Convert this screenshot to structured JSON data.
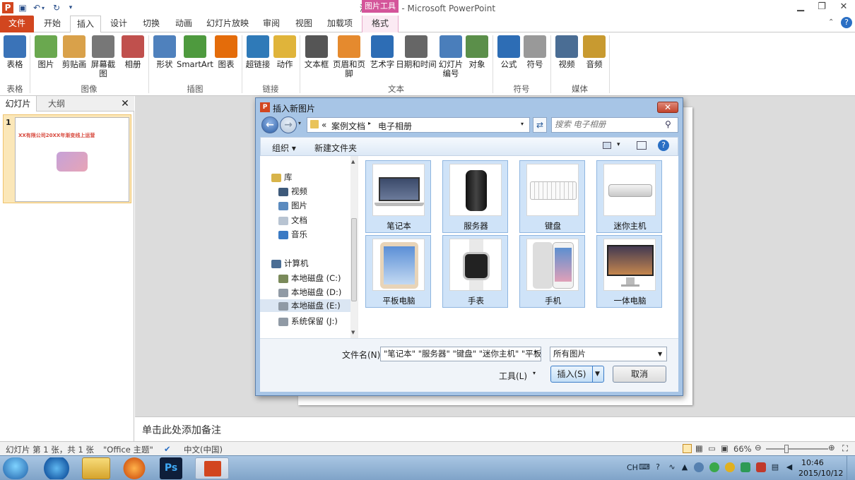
{
  "window": {
    "title": "演示文稿1 - Microsoft PowerPoint",
    "picture_tools": "图片工具",
    "min_icon": "minimize-icon",
    "max_icon": "restore-icon",
    "close_icon": "close-icon"
  },
  "quick_access": {
    "app_letter": "P",
    "save": "save-icon",
    "undo": "undo-icon",
    "redo": "redo-icon",
    "customize": "customize-icon"
  },
  "tabs": [
    {
      "label": "文件"
    },
    {
      "label": "开始"
    },
    {
      "label": "插入"
    },
    {
      "label": "设计"
    },
    {
      "label": "切换"
    },
    {
      "label": "动画"
    },
    {
      "label": "幻灯片放映"
    },
    {
      "label": "审阅"
    },
    {
      "label": "视图"
    },
    {
      "label": "加载项"
    },
    {
      "label": "格式"
    }
  ],
  "ribbon": {
    "buttons": [
      {
        "label": "表格",
        "icon": "table-icon",
        "color": "#3a73b8"
      },
      {
        "label": "图片",
        "icon": "picture-icon",
        "color": "#6aa84f"
      },
      {
        "label": "剪贴画",
        "icon": "clipart-icon",
        "color": "#d9a14a"
      },
      {
        "label": "屏幕截图",
        "icon": "screenshot-icon",
        "color": "#777777"
      },
      {
        "label": "相册",
        "icon": "album-icon",
        "color": "#c0504d"
      },
      {
        "label": "形状",
        "icon": "shapes-icon",
        "color": "#4f81bd"
      },
      {
        "label": "SmartArt",
        "icon": "smartart-icon",
        "color": "#4e9a3e"
      },
      {
        "label": "图表",
        "icon": "chart-icon",
        "color": "#e46c0a"
      },
      {
        "label": "超链接",
        "icon": "hyperlink-icon",
        "color": "#2f7ab8"
      },
      {
        "label": "动作",
        "icon": "action-icon",
        "color": "#e0b43a"
      },
      {
        "label": "文本框",
        "icon": "textbox-icon",
        "color": "#555555"
      },
      {
        "label": "页眉和页脚",
        "icon": "header-footer-icon",
        "color": "#e58a2e"
      },
      {
        "label": "艺术字",
        "icon": "wordart-icon",
        "color": "#2d6db5"
      },
      {
        "label": "日期和时间",
        "icon": "datetime-icon",
        "color": "#666666"
      },
      {
        "label": "幻灯片\n编号",
        "icon": "slide-number-icon",
        "color": "#4a7ebb"
      },
      {
        "label": "对象",
        "icon": "object-icon",
        "color": "#5b8f4a"
      },
      {
        "label": "公式",
        "icon": "equation-icon",
        "color": "#2d6db5"
      },
      {
        "label": "符号",
        "icon": "symbol-icon",
        "color": "#999999"
      },
      {
        "label": "视频",
        "icon": "video-icon",
        "color": "#4a6d94"
      },
      {
        "label": "音频",
        "icon": "audio-icon",
        "color": "#c89a30"
      }
    ],
    "groups": [
      "表格",
      "图像",
      "插图",
      "链接",
      "文本",
      "符号",
      "媒体"
    ]
  },
  "left_panel": {
    "tabs": [
      "幻灯片",
      "大纲"
    ],
    "close": "close-icon",
    "slide_number": "1",
    "thumb_title": "XX有限公司20XX年渐变线上运营"
  },
  "notes": {
    "placeholder": "单击此处添加备注"
  },
  "status": {
    "slide_info": "幻灯片 第 1 张，共 1 张",
    "theme": "\"Office 主题\"",
    "language": "中文(中国)",
    "zoom": "66%",
    "zoom_level": 0.66
  },
  "taskbar": {
    "apps": [
      "start-orb-icon",
      "ie-icon",
      "explorer-icon",
      "media-player-icon",
      "photoshop-icon",
      "powerpoint-icon"
    ],
    "ps_label": "Ps",
    "lang": "CH",
    "time": "10:46",
    "date": "2015/10/12"
  },
  "dialog": {
    "title": "插入新图片",
    "address": {
      "chevron": "«",
      "path": [
        "案例文档",
        "电子相册"
      ]
    },
    "search_placeholder": "搜索 电子相册",
    "toolbar": {
      "organize": "组织 ▾",
      "new_folder": "新建文件夹"
    },
    "tree": [
      {
        "label": "库",
        "icon": "library-icon",
        "color": "#d8b44a",
        "indent": 0
      },
      {
        "label": "视频",
        "icon": "video-folder-icon",
        "color": "#3e5a7a",
        "indent": 1
      },
      {
        "label": "图片",
        "icon": "pictures-folder-icon",
        "color": "#5b8bbf",
        "indent": 1
      },
      {
        "label": "文档",
        "icon": "documents-folder-icon",
        "color": "#b8c4d2",
        "indent": 1
      },
      {
        "label": "音乐",
        "icon": "music-folder-icon",
        "color": "#3a7ac4",
        "indent": 1
      },
      {
        "label": "计算机",
        "icon": "computer-icon",
        "color": "#4a6d94",
        "indent": 0
      },
      {
        "label": "本地磁盘 (C:)",
        "icon": "drive-c-icon",
        "color": "#7a8a5a",
        "indent": 1
      },
      {
        "label": "本地磁盘 (D:)",
        "icon": "drive-icon",
        "color": "#909aa5",
        "indent": 1
      },
      {
        "label": "本地磁盘 (E:)",
        "icon": "drive-icon",
        "color": "#909aa5",
        "indent": 1,
        "selected": true
      },
      {
        "label": "系统保留 (J:)",
        "icon": "drive-icon",
        "color": "#909aa5",
        "indent": 1
      }
    ],
    "files": [
      {
        "label": "笔记本",
        "icon": "laptop-thumbnail"
      },
      {
        "label": "服务器",
        "icon": "server-thumbnail"
      },
      {
        "label": "键盘",
        "icon": "keyboard-thumbnail"
      },
      {
        "label": "迷你主机",
        "icon": "mini-pc-thumbnail"
      },
      {
        "label": "平板电脑",
        "icon": "tablet-thumbnail"
      },
      {
        "label": "手表",
        "icon": "watch-thumbnail"
      },
      {
        "label": "手机",
        "icon": "phone-thumbnail"
      },
      {
        "label": "一体电脑",
        "icon": "all-in-one-thumbnail"
      }
    ],
    "filename_label": "文件名(N):",
    "filename_value": "\"笔记本\" \"服务器\" \"键盘\" \"迷你主机\" \"平板电",
    "filetype": "所有图片",
    "tools": "工具(L)",
    "insert": "插入(S)",
    "cancel": "取消"
  }
}
